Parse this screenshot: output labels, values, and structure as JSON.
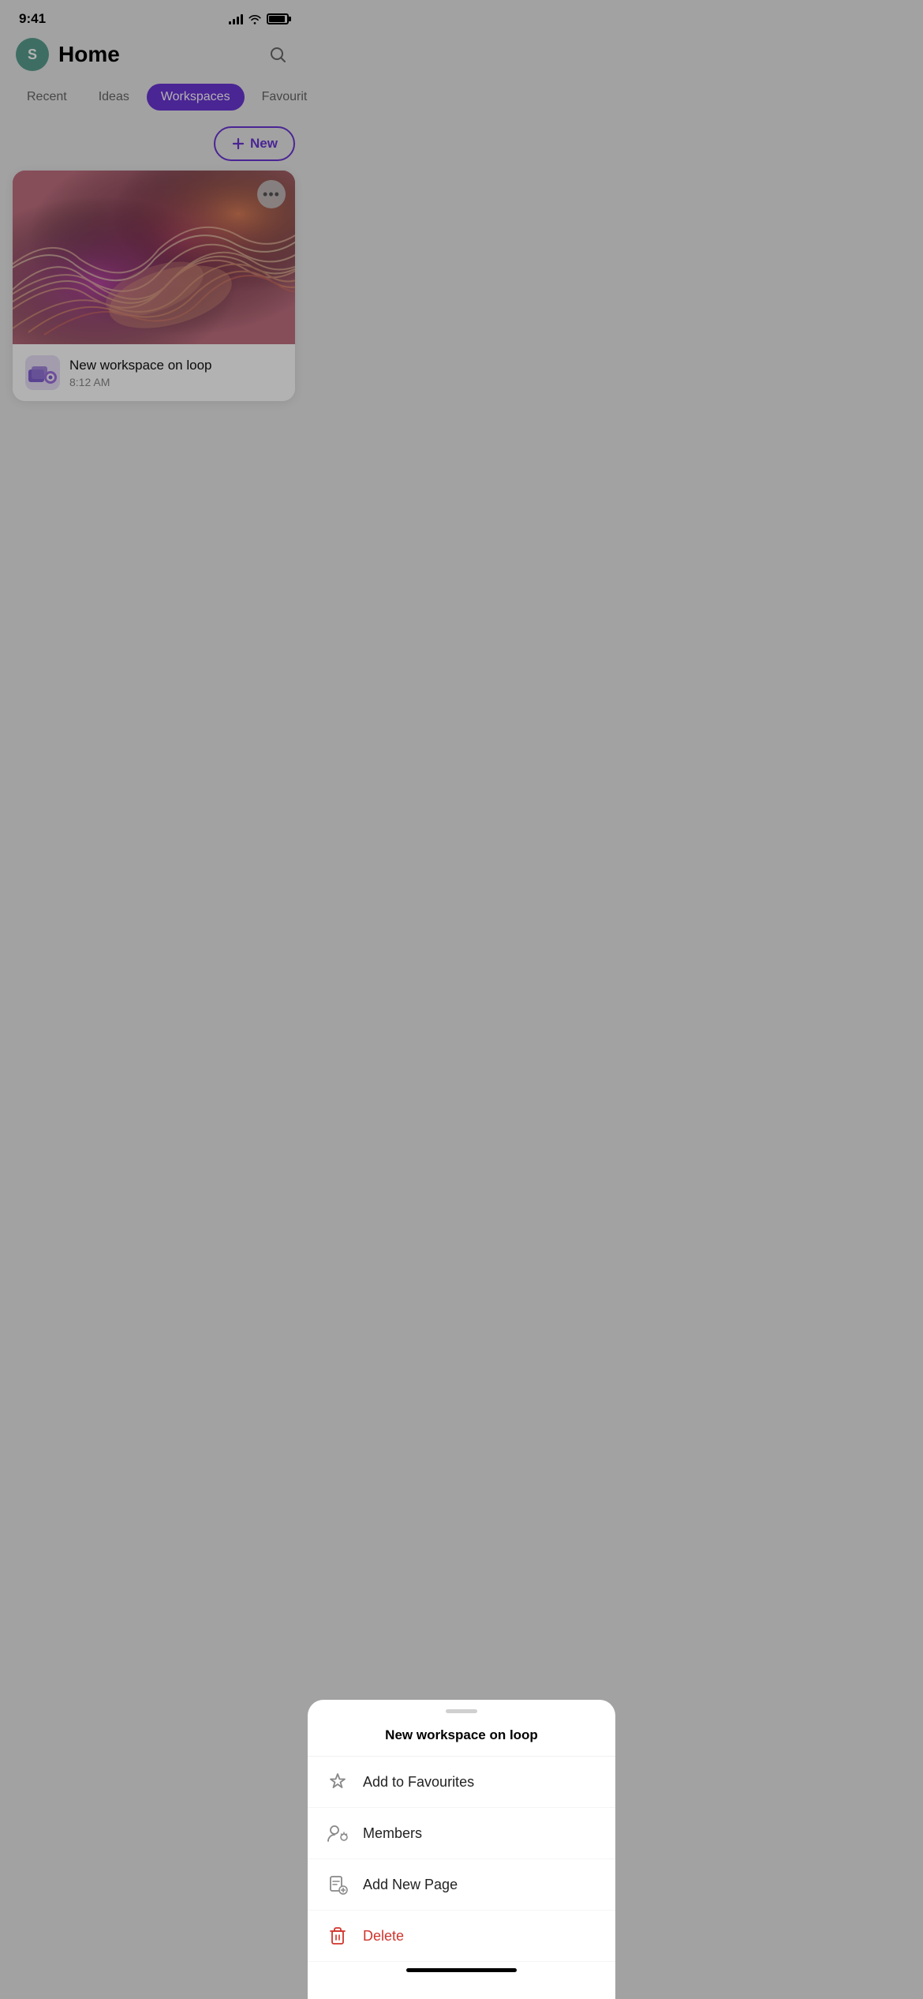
{
  "statusBar": {
    "time": "9:41",
    "avatarInitial": "S"
  },
  "header": {
    "title": "Home",
    "avatarInitial": "S",
    "avatarColor": "#5a9e8f"
  },
  "tabs": [
    {
      "id": "recent",
      "label": "Recent",
      "active": false
    },
    {
      "id": "ideas",
      "label": "Ideas",
      "active": false
    },
    {
      "id": "workspaces",
      "label": "Workspaces",
      "active": true
    },
    {
      "id": "favourites",
      "label": "Favourites",
      "active": false
    }
  ],
  "toolbar": {
    "new_label": "New"
  },
  "workspace": {
    "name": "New workspace on loop",
    "time": "8:12 AM"
  },
  "bottomSheet": {
    "title": "New workspace on loop",
    "menuItems": [
      {
        "id": "add-favourites",
        "label": "Add to Favourites",
        "icon": "star",
        "color": "normal"
      },
      {
        "id": "members",
        "label": "Members",
        "icon": "members",
        "color": "normal"
      },
      {
        "id": "add-page",
        "label": "Add New Page",
        "icon": "add-page",
        "color": "normal"
      },
      {
        "id": "delete",
        "label": "Delete",
        "icon": "trash",
        "color": "delete"
      }
    ]
  },
  "homeIndicator": {
    "visible": true
  }
}
